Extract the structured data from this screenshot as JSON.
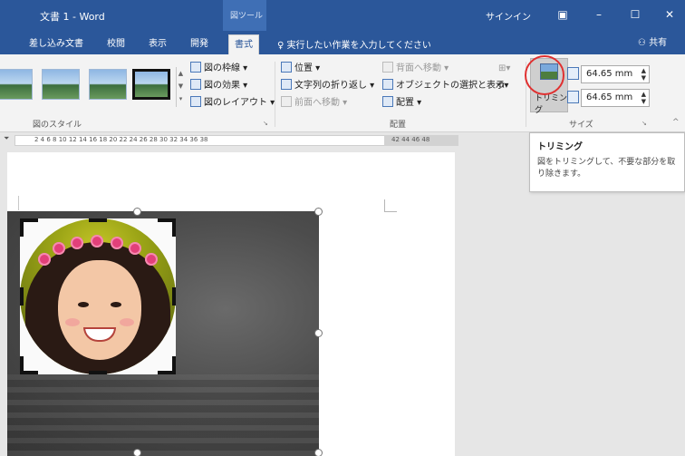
{
  "titlebar": {
    "title": "文書 1 - Word",
    "context_tab": "図ツール",
    "signin": "サインイン",
    "ribbon_display_icon": "ribbon-display-icon",
    "minimize_icon": "minimize-icon",
    "maximize_icon": "maximize-icon",
    "close_icon": "close-icon"
  },
  "tabs": [
    {
      "label": "差し込み文書",
      "active": false
    },
    {
      "label": "校閲",
      "active": false
    },
    {
      "label": "表示",
      "active": false
    },
    {
      "label": "開発",
      "active": false
    },
    {
      "label": "書式",
      "active": true
    }
  ],
  "tellme": {
    "label": "実行したい作業を入力してください"
  },
  "share": {
    "label": "共有"
  },
  "ribbon": {
    "picture_styles": {
      "label": "図のスタイル",
      "border": "図の枠線",
      "effects": "図の効果",
      "layout": "図のレイアウト"
    },
    "arrange": {
      "label": "配置",
      "position": "位置",
      "wrap_text": "文字列の折り返し",
      "bring_forward": "前面へ移動",
      "send_backward": "背面へ移動",
      "selection_pane": "オブジェクトの選択と表示",
      "align": "配置"
    },
    "size": {
      "label": "サイズ",
      "crop": "トリミング",
      "height": "64.65 mm",
      "width": "64.65 mm"
    }
  },
  "ruler": {
    "ticks": "2   4   6   8  10  12  14  16  18  20  22  24  26  28  30  32  34  36  38",
    "ticks_right": "42  44  46  48"
  },
  "tooltip": {
    "title": "トリミング",
    "description": "図をトリミングして、不要な部分を取り除きます。"
  },
  "colors": {
    "accent": "#2b579a",
    "ribbon_bg": "#f3f3f3",
    "highlight_circle": "#e03030"
  }
}
